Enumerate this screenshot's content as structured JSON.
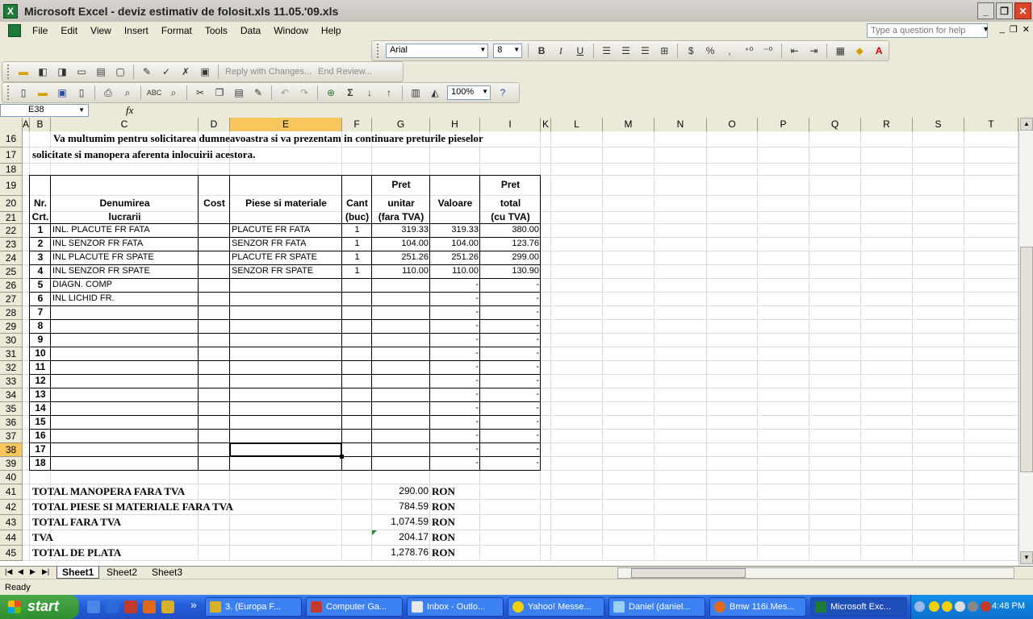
{
  "window": {
    "title": "Microsoft Excel - deviz estimativ de folosit.xls 11.05.'09.xls"
  },
  "menu": {
    "items": [
      "File",
      "Edit",
      "View",
      "Insert",
      "Format",
      "Tools",
      "Data",
      "Window",
      "Help"
    ],
    "help_placeholder": "Type a question for help"
  },
  "formatting": {
    "font": "Arial",
    "size": "8",
    "zoom": "100%"
  },
  "review_toolbar": {
    "reply": "Reply with Changes...",
    "end_review": "End Review..."
  },
  "formula_bar": {
    "name_box": "E38",
    "fx": "fx",
    "formula": ""
  },
  "sheet": {
    "columns": [
      "A",
      "B",
      "C",
      "D",
      "E",
      "F",
      "G",
      "H",
      "I",
      "K",
      "L",
      "M",
      "N",
      "O",
      "P",
      "Q",
      "R",
      "S",
      "T"
    ],
    "rows": [
      "16",
      "17",
      "18",
      "19",
      "20",
      "21",
      "22",
      "23",
      "24",
      "25",
      "26",
      "27",
      "28",
      "29",
      "30",
      "31",
      "32",
      "33",
      "34",
      "35",
      "36",
      "37",
      "38",
      "39",
      "40",
      "41",
      "42",
      "43",
      "44",
      "45"
    ],
    "selected_cell": "E38",
    "intro_line1": "Va multumim pentru solicitarea dumneavoastra si va prezentam in continuare preturile pieselor",
    "intro_line2": "solicitate si manopera aferenta inlocuirii acestora.",
    "headers": {
      "b20": "Nr.",
      "b21": "Crt.",
      "c20": "Denumirea",
      "c21": "lucrarii",
      "d20": "Cost",
      "e20": "Piese si materiale",
      "f20": "Cant",
      "f21": "(buc)",
      "g19": "Pret",
      "g20": "unitar",
      "g21": "(fara TVA)",
      "h20": "Valoare",
      "i19": "Pret",
      "i20": "total",
      "i21": "(cu TVA)"
    },
    "items": [
      {
        "nr": "1",
        "lucrare": "INL. PLACUTE FR FATA",
        "piese": "PLACUTE FR FATA",
        "cant": "1",
        "pret": "319.33",
        "valoare": "319.33",
        "total": "380.00"
      },
      {
        "nr": "2",
        "lucrare": "INL SENZOR FR FATA",
        "piese": "SENZOR FR FATA",
        "cant": "1",
        "pret": "104.00",
        "valoare": "104.00",
        "total": "123.76"
      },
      {
        "nr": "3",
        "lucrare": "INL PLACUTE FR SPATE",
        "piese": "PLACUTE FR SPATE",
        "cant": "1",
        "pret": "251.26",
        "valoare": "251.26",
        "total": "299.00"
      },
      {
        "nr": "4",
        "lucrare": "INL SENZOR FR SPATE",
        "piese": "SENZOR FR SPATE",
        "cant": "1",
        "pret": "110.00",
        "valoare": "110.00",
        "total": "130.90"
      },
      {
        "nr": "5",
        "lucrare": "DIAGN. COMP",
        "piese": "",
        "cant": "",
        "pret": "",
        "valoare": "-",
        "total": "-"
      },
      {
        "nr": "6",
        "lucrare": "INL LICHID FR.",
        "piese": "",
        "cant": "",
        "pret": "",
        "valoare": "-",
        "total": "-"
      },
      {
        "nr": "7",
        "lucrare": "",
        "piese": "",
        "cant": "",
        "pret": "",
        "valoare": "-",
        "total": "-"
      },
      {
        "nr": "8",
        "lucrare": "",
        "piese": "",
        "cant": "",
        "pret": "",
        "valoare": "-",
        "total": "-"
      },
      {
        "nr": "9",
        "lucrare": "",
        "piese": "",
        "cant": "",
        "pret": "",
        "valoare": "-",
        "total": "-"
      },
      {
        "nr": "10",
        "lucrare": "",
        "piese": "",
        "cant": "",
        "pret": "",
        "valoare": "-",
        "total": "-"
      },
      {
        "nr": "11",
        "lucrare": "",
        "piese": "",
        "cant": "",
        "pret": "",
        "valoare": "-",
        "total": "-"
      },
      {
        "nr": "12",
        "lucrare": "",
        "piese": "",
        "cant": "",
        "pret": "",
        "valoare": "-",
        "total": "-"
      },
      {
        "nr": "13",
        "lucrare": "",
        "piese": "",
        "cant": "",
        "pret": "",
        "valoare": "-",
        "total": "-"
      },
      {
        "nr": "14",
        "lucrare": "",
        "piese": "",
        "cant": "",
        "pret": "",
        "valoare": "-",
        "total": "-"
      },
      {
        "nr": "15",
        "lucrare": "",
        "piese": "",
        "cant": "",
        "pret": "",
        "valoare": "-",
        "total": "-"
      },
      {
        "nr": "16",
        "lucrare": "",
        "piese": "",
        "cant": "",
        "pret": "",
        "valoare": "-",
        "total": "-"
      },
      {
        "nr": "17",
        "lucrare": "",
        "piese": "",
        "cant": "",
        "pret": "",
        "valoare": "-",
        "total": "-"
      },
      {
        "nr": "18",
        "lucrare": "",
        "piese": "",
        "cant": "",
        "pret": "",
        "valoare": "-",
        "total": "-"
      }
    ],
    "totals": [
      {
        "label": "TOTAL MANOPERA  FARA TVA",
        "value": "290.00",
        "unit": "RON"
      },
      {
        "label": "TOTAL PIESE SI MATERIALE FARA TVA",
        "value": "784.59",
        "unit": "RON"
      },
      {
        "label": "TOTAL FARA TVA",
        "value": "1,074.59",
        "unit": "RON"
      },
      {
        "label": "TVA",
        "value": "204.17",
        "unit": "RON"
      },
      {
        "label": "TOTAL DE PLATA",
        "value": "1,278.76",
        "unit": "RON"
      }
    ]
  },
  "sheet_tabs": [
    "Sheet1",
    "Sheet2",
    "Sheet3"
  ],
  "status": "Ready",
  "taskbar": {
    "start": "start",
    "items": [
      "3.  (Europa F...",
      "Computer Ga...",
      "Inbox - Outlo...",
      "Yahoo! Messe...",
      "Daniel (daniel...",
      "Bmw 116i.Mes...",
      "Microsoft Exc..."
    ],
    "clock": "4:48 PM"
  },
  "colors": {
    "selected_header": "#f7c75e",
    "gridline": "#dadcdd",
    "taskbar": "#245edb",
    "start": "#2f8f2f"
  }
}
